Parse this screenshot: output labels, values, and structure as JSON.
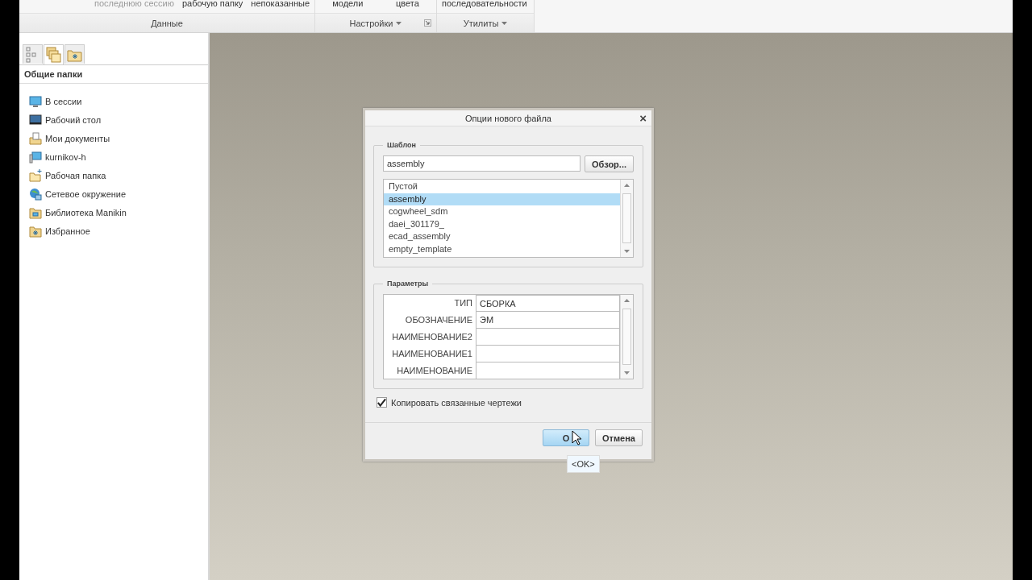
{
  "ribbon": {
    "groups": [
      {
        "label": "Данные",
        "dropdown": false,
        "launcher": false,
        "commands": [
          {
            "label": "последнюю сессию",
            "disabled": true
          },
          {
            "label": "рабочую папку",
            "disabled": false
          },
          {
            "label": "непоказанные",
            "disabled": false
          }
        ]
      },
      {
        "label": "Настройки",
        "dropdown": true,
        "launcher": true,
        "commands": [
          {
            "label": "модели",
            "disabled": false
          },
          {
            "label": "цвета",
            "disabled": false
          }
        ]
      },
      {
        "label": "Утилиты",
        "dropdown": true,
        "launcher": false,
        "commands": [
          {
            "label": "последовательности",
            "disabled": false
          }
        ]
      }
    ]
  },
  "folder_panel": {
    "tabs": [
      {
        "selected": false
      },
      {
        "selected": true
      },
      {
        "selected": false
      }
    ],
    "title": "Общие папки",
    "items": [
      {
        "label": "В сессии"
      },
      {
        "label": "Рабочий стол"
      },
      {
        "label": "Мои документы"
      },
      {
        "label": "kurnikov-h"
      },
      {
        "label": "Рабочая папка"
      },
      {
        "label": "Сетевое окружение"
      },
      {
        "label": "Библиотека Manikin"
      },
      {
        "label": "Избранное"
      }
    ]
  },
  "dialog": {
    "title": "Опции нового файла",
    "close": "×",
    "template": {
      "legend": "Шаблон",
      "value": "assembly",
      "browse": "Обзор...",
      "options": [
        {
          "label": "Пустой",
          "selected": false
        },
        {
          "label": "assembly",
          "selected": true
        },
        {
          "label": "cogwheel_sdm",
          "selected": false
        },
        {
          "label": "daei_301179_",
          "selected": false
        },
        {
          "label": "ecad_assembly",
          "selected": false
        },
        {
          "label": "empty_template",
          "selected": false
        }
      ]
    },
    "parameters": {
      "legend": "Параметры",
      "rows": [
        {
          "name": "ТИП",
          "value": "СБОРКА"
        },
        {
          "name": "ОБОЗНАЧЕНИЕ",
          "value": "ЭМ"
        },
        {
          "name": "НАИМЕНОВАНИЕ2",
          "value": ""
        },
        {
          "name": "НАИМЕНОВАНИЕ1",
          "value": ""
        },
        {
          "name": "НАИМЕНОВАНИЕ",
          "value": ""
        }
      ]
    },
    "copy_drawings": {
      "label": "Копировать связанные чертежи",
      "checked": true
    },
    "buttons": [
      {
        "label": "O",
        "kind": "primary"
      },
      {
        "label": "Отмена",
        "kind": "secondary"
      }
    ],
    "tooltip": "<OK>"
  }
}
